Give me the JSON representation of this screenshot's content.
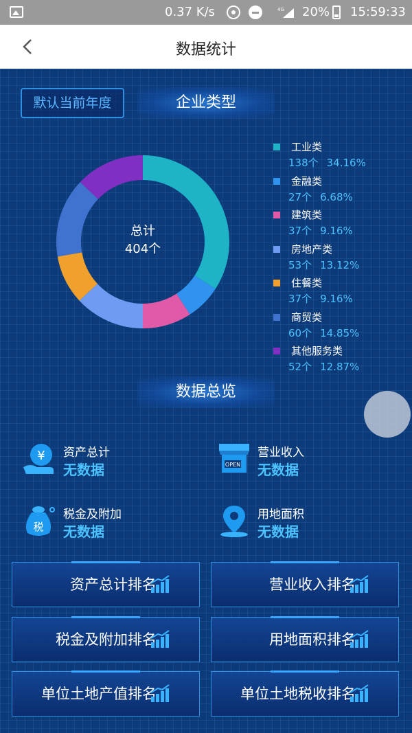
{
  "status_bar": {
    "speed": "0.37 K/s",
    "battery": "20%",
    "time": "15:59:33",
    "net": "4G"
  },
  "nav": {
    "title": "数据统计"
  },
  "year_button": "默认当前年度",
  "enterprise_section": {
    "title": "企业类型",
    "center_label": "总计",
    "center_value": "404个"
  },
  "chart_data": {
    "type": "pie",
    "title": "企业类型",
    "total": 404,
    "slices": [
      {
        "label": "工业类",
        "count": 138,
        "count_text": "138个",
        "percent": 34.16,
        "percent_text": "34.16%",
        "color": "#1eb3c7"
      },
      {
        "label": "金融类",
        "count": 27,
        "count_text": "27个",
        "percent": 6.68,
        "percent_text": "6.68%",
        "color": "#2f93ef"
      },
      {
        "label": "建筑类",
        "count": 37,
        "count_text": "37个",
        "percent": 9.16,
        "percent_text": "9.16%",
        "color": "#e15aa8"
      },
      {
        "label": "房地产类",
        "count": 53,
        "count_text": "53个",
        "percent": 13.12,
        "percent_text": "13.12%",
        "color": "#6f9cf2"
      },
      {
        "label": "住餐类",
        "count": 37,
        "count_text": "37个",
        "percent": 9.16,
        "percent_text": "9.16%",
        "color": "#f0a02c"
      },
      {
        "label": "商贸类",
        "count": 60,
        "count_text": "60个",
        "percent": 14.85,
        "percent_text": "14.85%",
        "color": "#3f73cf"
      },
      {
        "label": "其他服务类",
        "count": 52,
        "count_text": "52个",
        "percent": 12.87,
        "percent_text": "12.87%",
        "color": "#7f2fc2"
      }
    ],
    "legend_placement": "right"
  },
  "overview": {
    "title": "数据总览",
    "stats": [
      {
        "label": "资产总计",
        "value": "无数据",
        "icon": "money-hand-icon"
      },
      {
        "label": "营业收入",
        "value": "无数据",
        "icon": "shop-open-icon"
      },
      {
        "label": "税金及附加",
        "value": "无数据",
        "icon": "tax-bag-icon"
      },
      {
        "label": "用地面积",
        "value": "无数据",
        "icon": "map-pin-icon"
      }
    ],
    "shop_sign": "OPEN",
    "tax_char": "税",
    "money_char": "¥"
  },
  "rankings": [
    {
      "label": "资产总计排名"
    },
    {
      "label": "营业收入排名"
    },
    {
      "label": "税金及附加排名"
    },
    {
      "label": "用地面积排名"
    },
    {
      "label": "单位土地产值排名"
    },
    {
      "label": "单位土地税收排名"
    }
  ]
}
